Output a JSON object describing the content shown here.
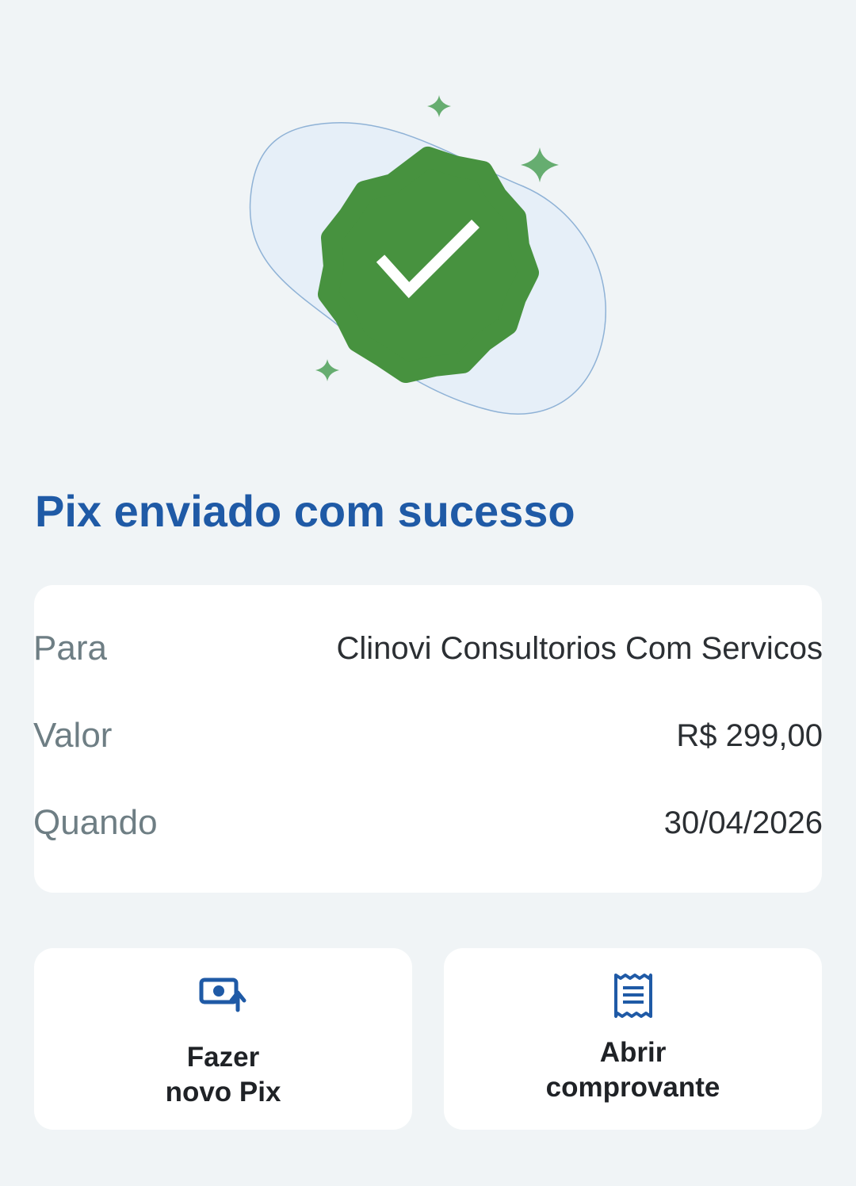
{
  "status": {
    "title": "Pix enviado com sucesso"
  },
  "details": [
    {
      "label": "Para",
      "value": "Clinovi Consultorios Com Servicos"
    },
    {
      "label": "Valor",
      "value": "R$ 299,00"
    },
    {
      "label": "Quando",
      "value": "30/04/2026"
    }
  ],
  "actions": {
    "new_pix": {
      "line1": "Fazer",
      "line2": "novo Pix",
      "icon": "send-money-icon"
    },
    "receipt": {
      "line1": "Abrir",
      "line2": "comprovante",
      "icon": "receipt-icon"
    }
  },
  "colors": {
    "accent_blue": "#1f5aa6",
    "success_green": "#47923f",
    "sparkle_green": "#66ad70",
    "background": "#f0f4f6",
    "card": "#ffffff"
  }
}
